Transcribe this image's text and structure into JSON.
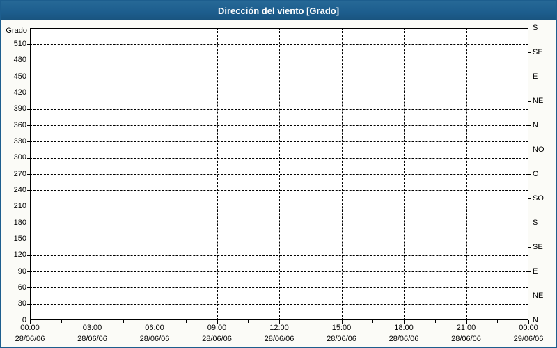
{
  "window": {
    "title": "Dirección del viento [Grado]"
  },
  "chart_data": {
    "type": "line",
    "title": "Dirección del viento [Grado]",
    "ylabel": "Grado",
    "grid": "dashed",
    "series": [],
    "y_axis": {
      "min": 0,
      "max": 540,
      "step": 30,
      "tick_labels": [
        "0",
        "30",
        "60",
        "90",
        "120",
        "150",
        "180",
        "210",
        "240",
        "270",
        "300",
        "330",
        "360",
        "390",
        "420",
        "450",
        "480",
        "510"
      ]
    },
    "right_axis": {
      "step_degrees": 45,
      "ticks": [
        {
          "deg": 0,
          "label": "N"
        },
        {
          "deg": 45,
          "label": "NE"
        },
        {
          "deg": 90,
          "label": "E"
        },
        {
          "deg": 135,
          "label": "SE"
        },
        {
          "deg": 180,
          "label": "S"
        },
        {
          "deg": 225,
          "label": "SO"
        },
        {
          "deg": 270,
          "label": "O"
        },
        {
          "deg": 315,
          "label": "NO"
        },
        {
          "deg": 360,
          "label": "N"
        },
        {
          "deg": 405,
          "label": "NE"
        },
        {
          "deg": 450,
          "label": "E"
        },
        {
          "deg": 495,
          "label": "SE"
        },
        {
          "deg": 540,
          "label": "S"
        }
      ]
    },
    "x_axis": {
      "minor_ticks_per_interval": 1,
      "major_ticks": [
        {
          "time": "00:00",
          "date": "28/06/06"
        },
        {
          "time": "03:00",
          "date": "28/06/06"
        },
        {
          "time": "06:00",
          "date": "28/06/06"
        },
        {
          "time": "09:00",
          "date": "28/06/06"
        },
        {
          "time": "12:00",
          "date": "28/06/06"
        },
        {
          "time": "15:00",
          "date": "28/06/06"
        },
        {
          "time": "18:00",
          "date": "28/06/06"
        },
        {
          "time": "21:00",
          "date": "28/06/06"
        },
        {
          "time": "00:00",
          "date": "29/06/06"
        }
      ]
    },
    "colors": {
      "titlebar": "#1d5e8e",
      "frame": "#1d5e8e",
      "title_text": "#ffffff",
      "background": "#fbfbf7",
      "plot_background": "#ffffff",
      "grid": "#000000",
      "text": "#000000"
    }
  }
}
